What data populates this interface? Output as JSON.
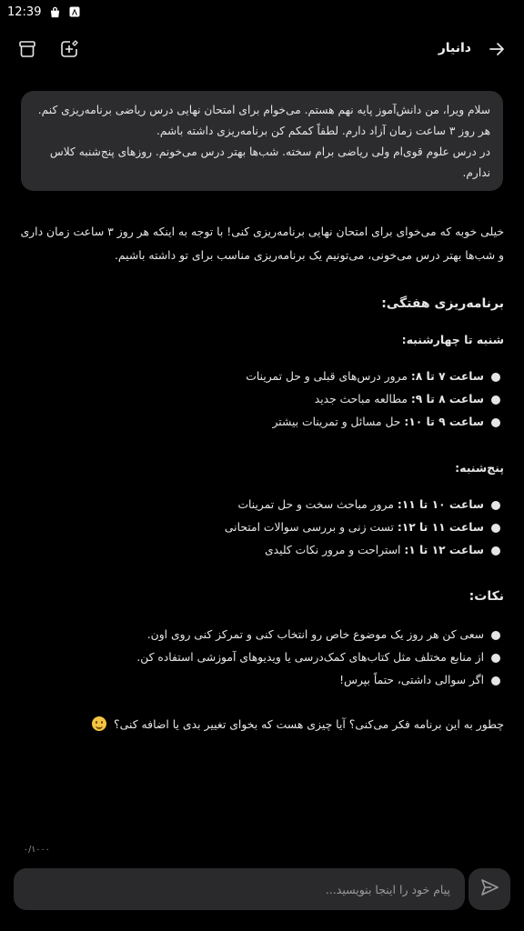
{
  "status_bar": {
    "time": "12:39"
  },
  "header": {
    "title": "دانیار"
  },
  "user_message": {
    "lines": [
      "سلام ویرا، من دانش‌آموز پایه نهم هستم. می‌خوام برای امتحان نهایی درس ریاضی برنامه‌ریزی کنم. هر روز ۳ ساعت زمان آزاد دارم. لطفاً کمکم کن برنامه‌ریزی داشته باشم.",
      "در درس علوم قوی‌ام ولی ریاضی برام سخته. شب‌ها بهتر درس می‌خونم. روزهای پنج‌شنبه کلاس ندارم."
    ]
  },
  "answer": {
    "intro": "خیلی خوبه که می‌خوای برای امتحان نهایی برنامه‌ریزی کنی! با توجه به اینکه هر روز ۳ ساعت زمان داری و شب‌ها بهتر درس می‌خونی، می‌تونیم یک برنامه‌ریزی مناسب برای تو داشته باشیم.",
    "plan_heading": "برنامه‌ریزی هفتگی:",
    "weekday_heading": "شنبه تا چهارشنبه:",
    "weekday_items": [
      {
        "time": "ساعت ۷ تا ۸:",
        "text": " مرور درس‌های قبلی و حل تمرینات"
      },
      {
        "time": "ساعت ۸ تا ۹:",
        "text": " مطالعه مباحث جدید"
      },
      {
        "time": "ساعت ۹ تا ۱۰:",
        "text": " حل مسائل و تمرینات بیشتر"
      }
    ],
    "thursday_heading": "پنج‌شنبه:",
    "thursday_items": [
      {
        "time": "ساعت ۱۰ تا ۱۱:",
        "text": " مرور مباحث سخت و حل تمرینات"
      },
      {
        "time": "ساعت ۱۱ تا ۱۲:",
        "text": " تست زنی و بررسی سوالات امتحانی"
      },
      {
        "time": "ساعت ۱۲ تا ۱:",
        "text": " استراحت و مرور نکات کلیدی"
      }
    ],
    "tips_heading": "نکات:",
    "tips": [
      "سعی کن هر روز یک موضوع خاص رو انتخاب کنی و تمرکز کنی روی اون.",
      "از منابع مختلف مثل کتاب‌های کمک‌درسی یا ویدیوهای آموزشی استفاده کن.",
      "اگر سوالی داشتی، حتماً بپرس!"
    ],
    "closing": "چطور به این برنامه فکر می‌کنی؟ آیا چیزی هست که بخوای تغییر بدی یا اضافه کنی؟"
  },
  "composer": {
    "char_counter": "۰/۱۰۰۰",
    "placeholder": "پیام خود را اینجا بنویسید..."
  },
  "icons": {
    "back": "arrow-right-icon",
    "new_chat": "new-chat-icon",
    "archive": "archive-icon",
    "send": "send-icon",
    "emoji": "smiling-face-icon"
  }
}
